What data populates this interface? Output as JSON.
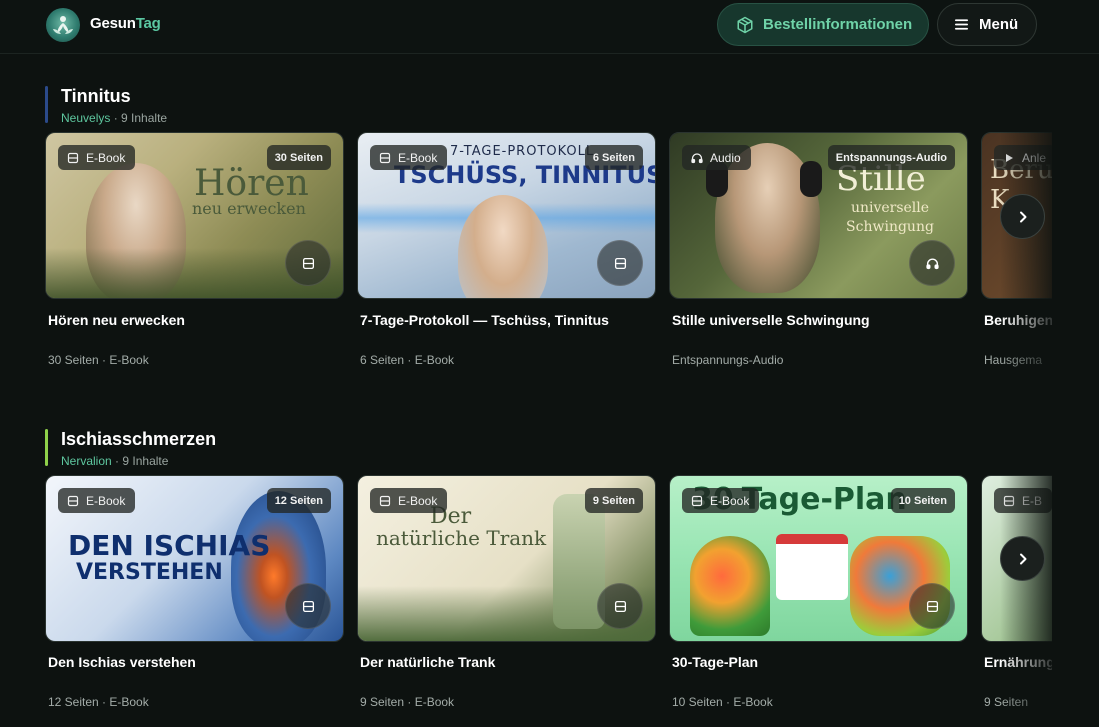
{
  "header": {
    "brand_part1": "Gesun",
    "brand_part2": "Tag",
    "order_label": "Bestellinformationen",
    "menu_label": "Menü"
  },
  "sections": [
    {
      "title": "Tinnitus",
      "brand": "Neuvelys",
      "count": "· 9 Inhalte",
      "accent": "#2b4a8a",
      "cards": [
        {
          "type": "E-Book",
          "size": "30 Seiten",
          "title": "Hören neu erwecken",
          "meta": "30 Seiten · E-Book",
          "art_line1": "Hören",
          "art_line2": "neu erwecken",
          "icon": "book-icon"
        },
        {
          "type": "E-Book",
          "size": "6 Seiten",
          "title": "7-Tage-Protokoll — Tschüss, Tinnitus",
          "meta": "6 Seiten · E-Book",
          "art_line1": "7-TAGE-PROTOKOLL",
          "art_line2": "TSCHÜSS, TINNITUS",
          "icon": "book-icon"
        },
        {
          "type": "Audio",
          "size": "Entspannungs-Audio",
          "title": "Stille universelle Schwingung",
          "meta": "Entspannungs-Audio",
          "art_line1": "Stille",
          "art_line2": "universelle Schwingung",
          "icon": "headphones-icon"
        },
        {
          "type": "Anle",
          "size": "",
          "title": "Beruhigen",
          "meta": "Hausgema",
          "art_line1": "Beru",
          "art_line2": "K",
          "icon": "play-icon"
        }
      ]
    },
    {
      "title": "Ischiasschmerzen",
      "brand": "Nervalion",
      "count": "· 9 Inhalte",
      "accent": "#8fd14a",
      "cards": [
        {
          "type": "E-Book",
          "size": "12 Seiten",
          "title": "Den Ischias verstehen",
          "meta": "12 Seiten · E-Book",
          "art_line1": "DEN ISCHIAS",
          "art_line2": "VERSTEHEN",
          "icon": "book-icon"
        },
        {
          "type": "E-Book",
          "size": "9 Seiten",
          "title": "Der natürliche Trank",
          "meta": "9 Seiten · E-Book",
          "art_line1": "Der",
          "art_line2": "natürliche Trank",
          "icon": "book-icon"
        },
        {
          "type": "E-Book",
          "size": "10 Seiten",
          "title": "30-Tage-Plan",
          "meta": "10 Seiten · E-Book",
          "art_line1": "30-Tage-Plan",
          "art_line2": "",
          "icon": "book-icon"
        },
        {
          "type": "E-B",
          "size": "",
          "title": "Ernährung",
          "meta": "9 Seiten",
          "art_line1": "",
          "art_line2": "",
          "icon": "book-icon"
        }
      ]
    }
  ]
}
